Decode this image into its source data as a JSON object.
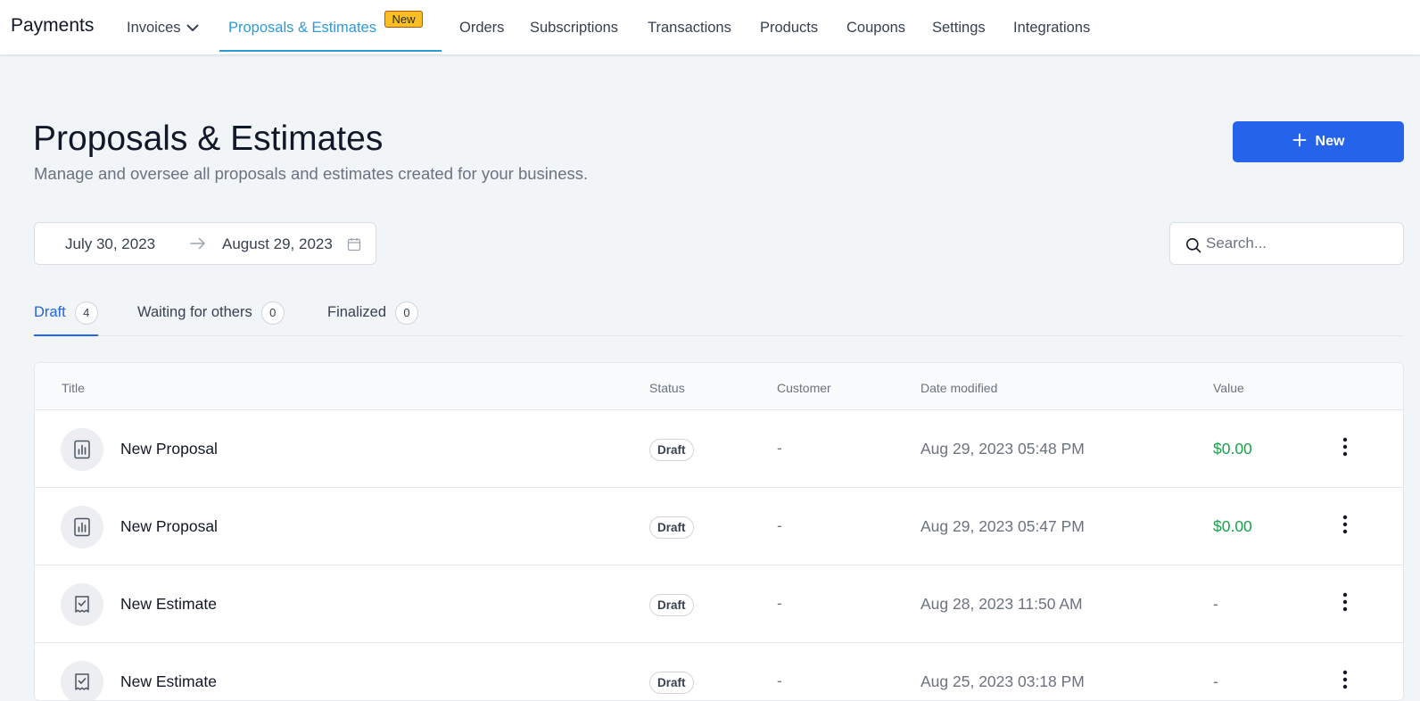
{
  "app": {
    "title": "Payments"
  },
  "nav": {
    "items": [
      {
        "label": "Invoices",
        "has_dropdown": true
      },
      {
        "label": "Proposals & Estimates",
        "active": true,
        "badge": "New"
      },
      {
        "label": "Orders"
      },
      {
        "label": "Subscriptions"
      },
      {
        "label": "Transactions"
      },
      {
        "label": "Products"
      },
      {
        "label": "Coupons"
      },
      {
        "label": "Settings"
      },
      {
        "label": "Integrations"
      }
    ]
  },
  "header": {
    "title": "Proposals & Estimates",
    "subtitle": "Manage and oversee all proposals and estimates created for your business.",
    "new_button": {
      "label": "New",
      "icon": "plus-icon"
    }
  },
  "filters": {
    "date_start": "July 30, 2023",
    "date_end": "August 29, 2023",
    "search_placeholder": "Search..."
  },
  "tabs": [
    {
      "label": "Draft",
      "count": "4",
      "active": true
    },
    {
      "label": "Waiting for others",
      "count": "0"
    },
    {
      "label": "Finalized",
      "count": "0"
    }
  ],
  "table": {
    "columns": [
      "Title",
      "Status",
      "Customer",
      "Date modified",
      "Value"
    ],
    "rows": [
      {
        "icon": "proposal-icon",
        "title": "New Proposal",
        "status": "Draft",
        "customer": "-",
        "date": "Aug 29, 2023 05:48 PM",
        "value": "$0.00"
      },
      {
        "icon": "proposal-icon",
        "title": "New Proposal",
        "status": "Draft",
        "customer": "-",
        "date": "Aug 29, 2023 05:47 PM",
        "value": "$0.00"
      },
      {
        "icon": "estimate-icon",
        "title": "New Estimate",
        "status": "Draft",
        "customer": "-",
        "date": "Aug 28, 2023 11:50 AM",
        "value": "-"
      },
      {
        "icon": "estimate-icon",
        "title": "New Estimate",
        "status": "Draft",
        "customer": "-",
        "date": "Aug 25, 2023 03:18 PM",
        "value": "-"
      }
    ]
  },
  "colors": {
    "accent": "#2563eb",
    "nav_active": "#2f9bd6",
    "badge": "#fbbf24",
    "money": "#16a34a"
  }
}
